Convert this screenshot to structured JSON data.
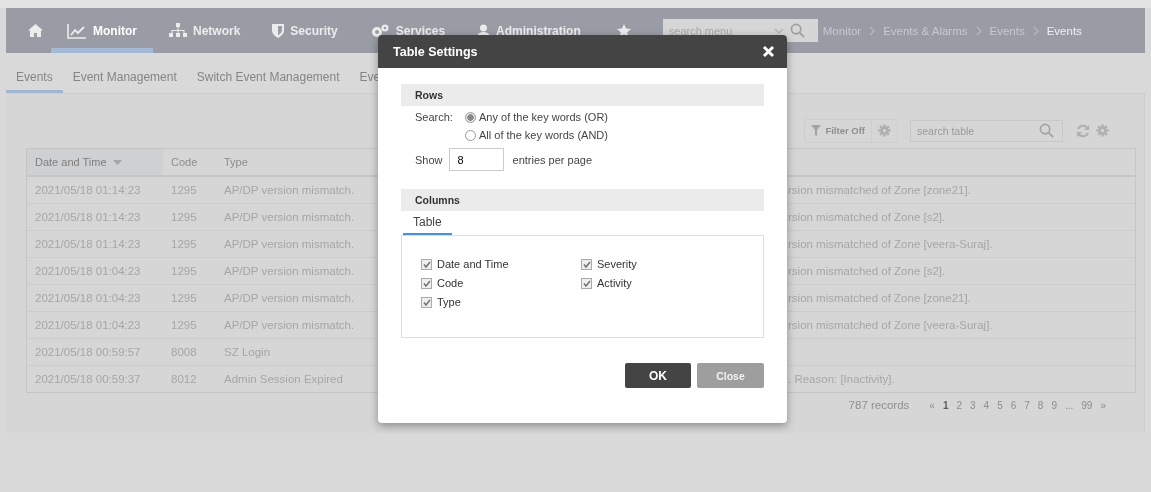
{
  "nav": {
    "tabs": [
      {
        "label": "Monitor",
        "selected": true
      },
      {
        "label": "Network",
        "selected": false
      },
      {
        "label": "Security",
        "selected": false
      },
      {
        "label": "Services",
        "selected": false
      },
      {
        "label": "Administration",
        "selected": false
      }
    ],
    "search": {
      "placeholder": "search menu"
    },
    "breadcrumb": [
      "Monitor",
      "Events & Alarms",
      "Events",
      "Events"
    ]
  },
  "sub_tabs": [
    {
      "label": "Events",
      "selected": true
    },
    {
      "label": "Event Management",
      "selected": false
    },
    {
      "label": "Switch Event Management",
      "selected": false
    },
    {
      "label": "Eve",
      "selected": false
    }
  ],
  "toolbar": {
    "filter": "Filter Off",
    "search": {
      "placeholder": "search table"
    }
  },
  "table": {
    "columns": [
      {
        "label": "Date and Time",
        "sorted": true
      },
      {
        "label": "Code",
        "sorted": false
      },
      {
        "label": "Type",
        "sorted": false
      }
    ],
    "rows": [
      [
        "2021/05/18 01:14:23",
        "1295",
        "AP/DP version mismatch.",
        "rsion mismatched of Zone [zone21]."
      ],
      [
        "2021/05/18 01:14:23",
        "1295",
        "AP/DP version mismatch.",
        "rsion mismatched of Zone [s2]."
      ],
      [
        "2021/05/18 01:14:23",
        "1295",
        "AP/DP version mismatch.",
        "rsion mismatched of Zone [veera-Suraj]."
      ],
      [
        "2021/05/18 01:04:23",
        "1295",
        "AP/DP version mismatch.",
        "rsion mismatched of Zone [s2]."
      ],
      [
        "2021/05/18 01:04:23",
        "1295",
        "AP/DP version mismatch.",
        "rsion mismatched of Zone [zone21]."
      ],
      [
        "2021/05/18 01:04:23",
        "1295",
        "AP/DP version mismatch.",
        "rsion mismatched of Zone [veera-Suraj]."
      ],
      [
        "2021/05/18 00:59:57",
        "8008",
        "SZ Login",
        null
      ],
      [
        "2021/05/18 00:59:37",
        "8012",
        "Admin Session Expired",
        ". Reason: [Inactivity]."
      ]
    ]
  },
  "pagination": {
    "records": "787 records",
    "pages": [
      {
        "label": "«",
        "selected": false
      },
      {
        "label": "1",
        "selected": true
      },
      {
        "label": "2",
        "selected": false
      },
      {
        "label": "3",
        "selected": false
      },
      {
        "label": "4",
        "selected": false
      },
      {
        "label": "5",
        "selected": false
      },
      {
        "label": "6",
        "selected": false
      },
      {
        "label": "7",
        "selected": false
      },
      {
        "label": "8",
        "selected": false
      },
      {
        "label": "9",
        "selected": false
      },
      {
        "label": "...",
        "selected": false
      },
      {
        "label": "99",
        "selected": false
      },
      {
        "label": "»",
        "selected": false
      }
    ]
  },
  "dialog": {
    "title": "Table Settings",
    "rows_section": "Rows",
    "search_label": "Search:",
    "radios": [
      {
        "label": "Any of the key words (OR)",
        "selected": true
      },
      {
        "label": "All of the key words (AND)",
        "selected": false
      }
    ],
    "show_label": "Show",
    "entries": "8",
    "entries_suffix": "entries per page",
    "columns_section": "Columns",
    "tabs": [
      {
        "label": "Table",
        "selected": true
      }
    ],
    "checkboxes": [
      {
        "label": "Date and Time",
        "checked": true
      },
      {
        "label": "Severity",
        "checked": true
      },
      {
        "label": "Code",
        "checked": true
      },
      {
        "label": "Activity",
        "checked": true
      },
      {
        "label": "Type",
        "checked": true
      }
    ],
    "buttons": [
      {
        "label": "OK",
        "kind": "primary"
      },
      {
        "label": "Close",
        "kind": "secondary"
      }
    ]
  }
}
